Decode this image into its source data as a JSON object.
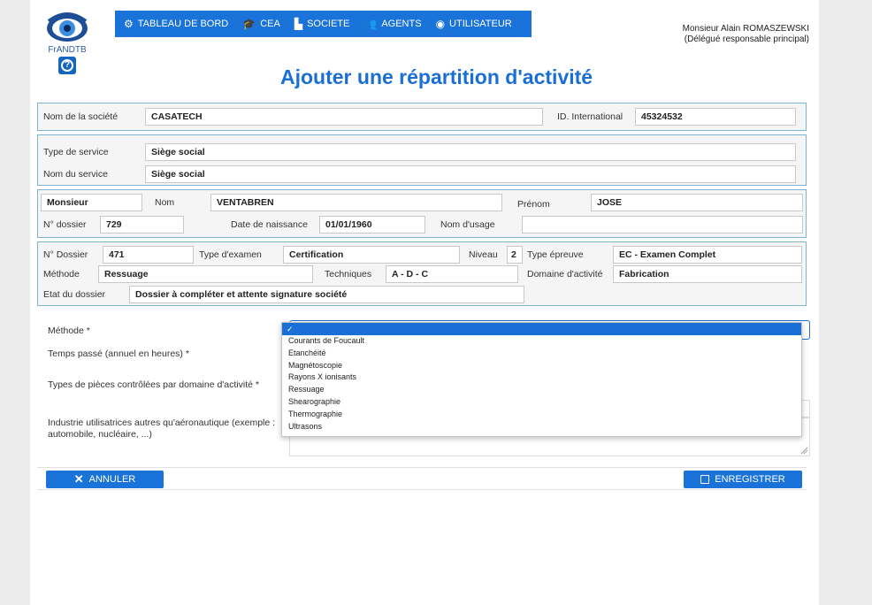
{
  "brand": {
    "logo_text": "FrANDTB",
    "help_label": "?"
  },
  "nav": [
    {
      "label": "TABLEAU DE BORD",
      "icon": "dashboard-icon"
    },
    {
      "label": "CEA",
      "icon": "graduation-cap-icon"
    },
    {
      "label": "SOCIETE",
      "icon": "factory-icon"
    },
    {
      "label": "AGENTS",
      "icon": "users-icon"
    },
    {
      "label": "UTILISATEUR",
      "icon": "user-circle-icon"
    }
  ],
  "user": {
    "name": "Monsieur Alain ROMASZEWSKI",
    "role": "(Délégué responsable principal)"
  },
  "page_title": "Ajouter une répartition d'activité",
  "company": {
    "name_label": "Nom de la société",
    "name_value": "CASATECH",
    "intl_label": "ID. International",
    "intl_value": "45324532"
  },
  "service": {
    "type_label": "Type de service",
    "type_value": "Siège social",
    "name_label": "Nom du service",
    "name_value": "Siège social"
  },
  "person": {
    "civility": "Monsieur",
    "nom_label": "Nom",
    "nom_value": "VENTABREN",
    "prenom_label": "Prénom",
    "prenom_value": "JOSE",
    "dossier_label": "N° dossier",
    "dossier_value": "729",
    "birth_label": "Date de naissance",
    "birth_value": "01/01/1960",
    "usage_label": "Nom d'usage",
    "usage_value": ""
  },
  "exam": {
    "dossier_label": "N° Dossier",
    "dossier_value": "471",
    "type_label": "Type d'examen",
    "type_value": "Certification",
    "niveau_label": "Niveau",
    "niveau_value": "2",
    "epreuve_label": "Type épreuve",
    "epreuve_value": "EC - Examen Complet",
    "methode_label": "Méthode",
    "methode_value": "Ressuage",
    "tech_label": "Techniques",
    "tech_value": "A - D - C",
    "domaine_label": "Domaine d'activité",
    "domaine_value": "Fabrication",
    "etat_label": "Etat du dossier",
    "etat_value": "Dossier à compléter et attente signature société"
  },
  "form": {
    "methode_label": "Méthode *",
    "temps_label": "Temps passé (annuel en heures) *",
    "pieces_label": "Types de pièces contrôlées par domaine d'activité *",
    "industrie_label": "Industrie utilisatrices autres qu'aéronautique (exemple : automobile, nucléaire, ...)"
  },
  "dropdown": {
    "selected": "✓",
    "options": [
      "Courants de Foucault",
      "Etanchéité",
      "Magnétoscopie",
      "Rayons X ionisants",
      "Ressuage",
      "Shearographie",
      "Thermographie",
      "Ultrasons"
    ]
  },
  "actions": {
    "cancel": "ANNULER",
    "save": "ENREGISTRER"
  },
  "colors": {
    "primary": "#1a73d9",
    "title": "#1a6fd6",
    "section_border": "#7fb2cf"
  }
}
